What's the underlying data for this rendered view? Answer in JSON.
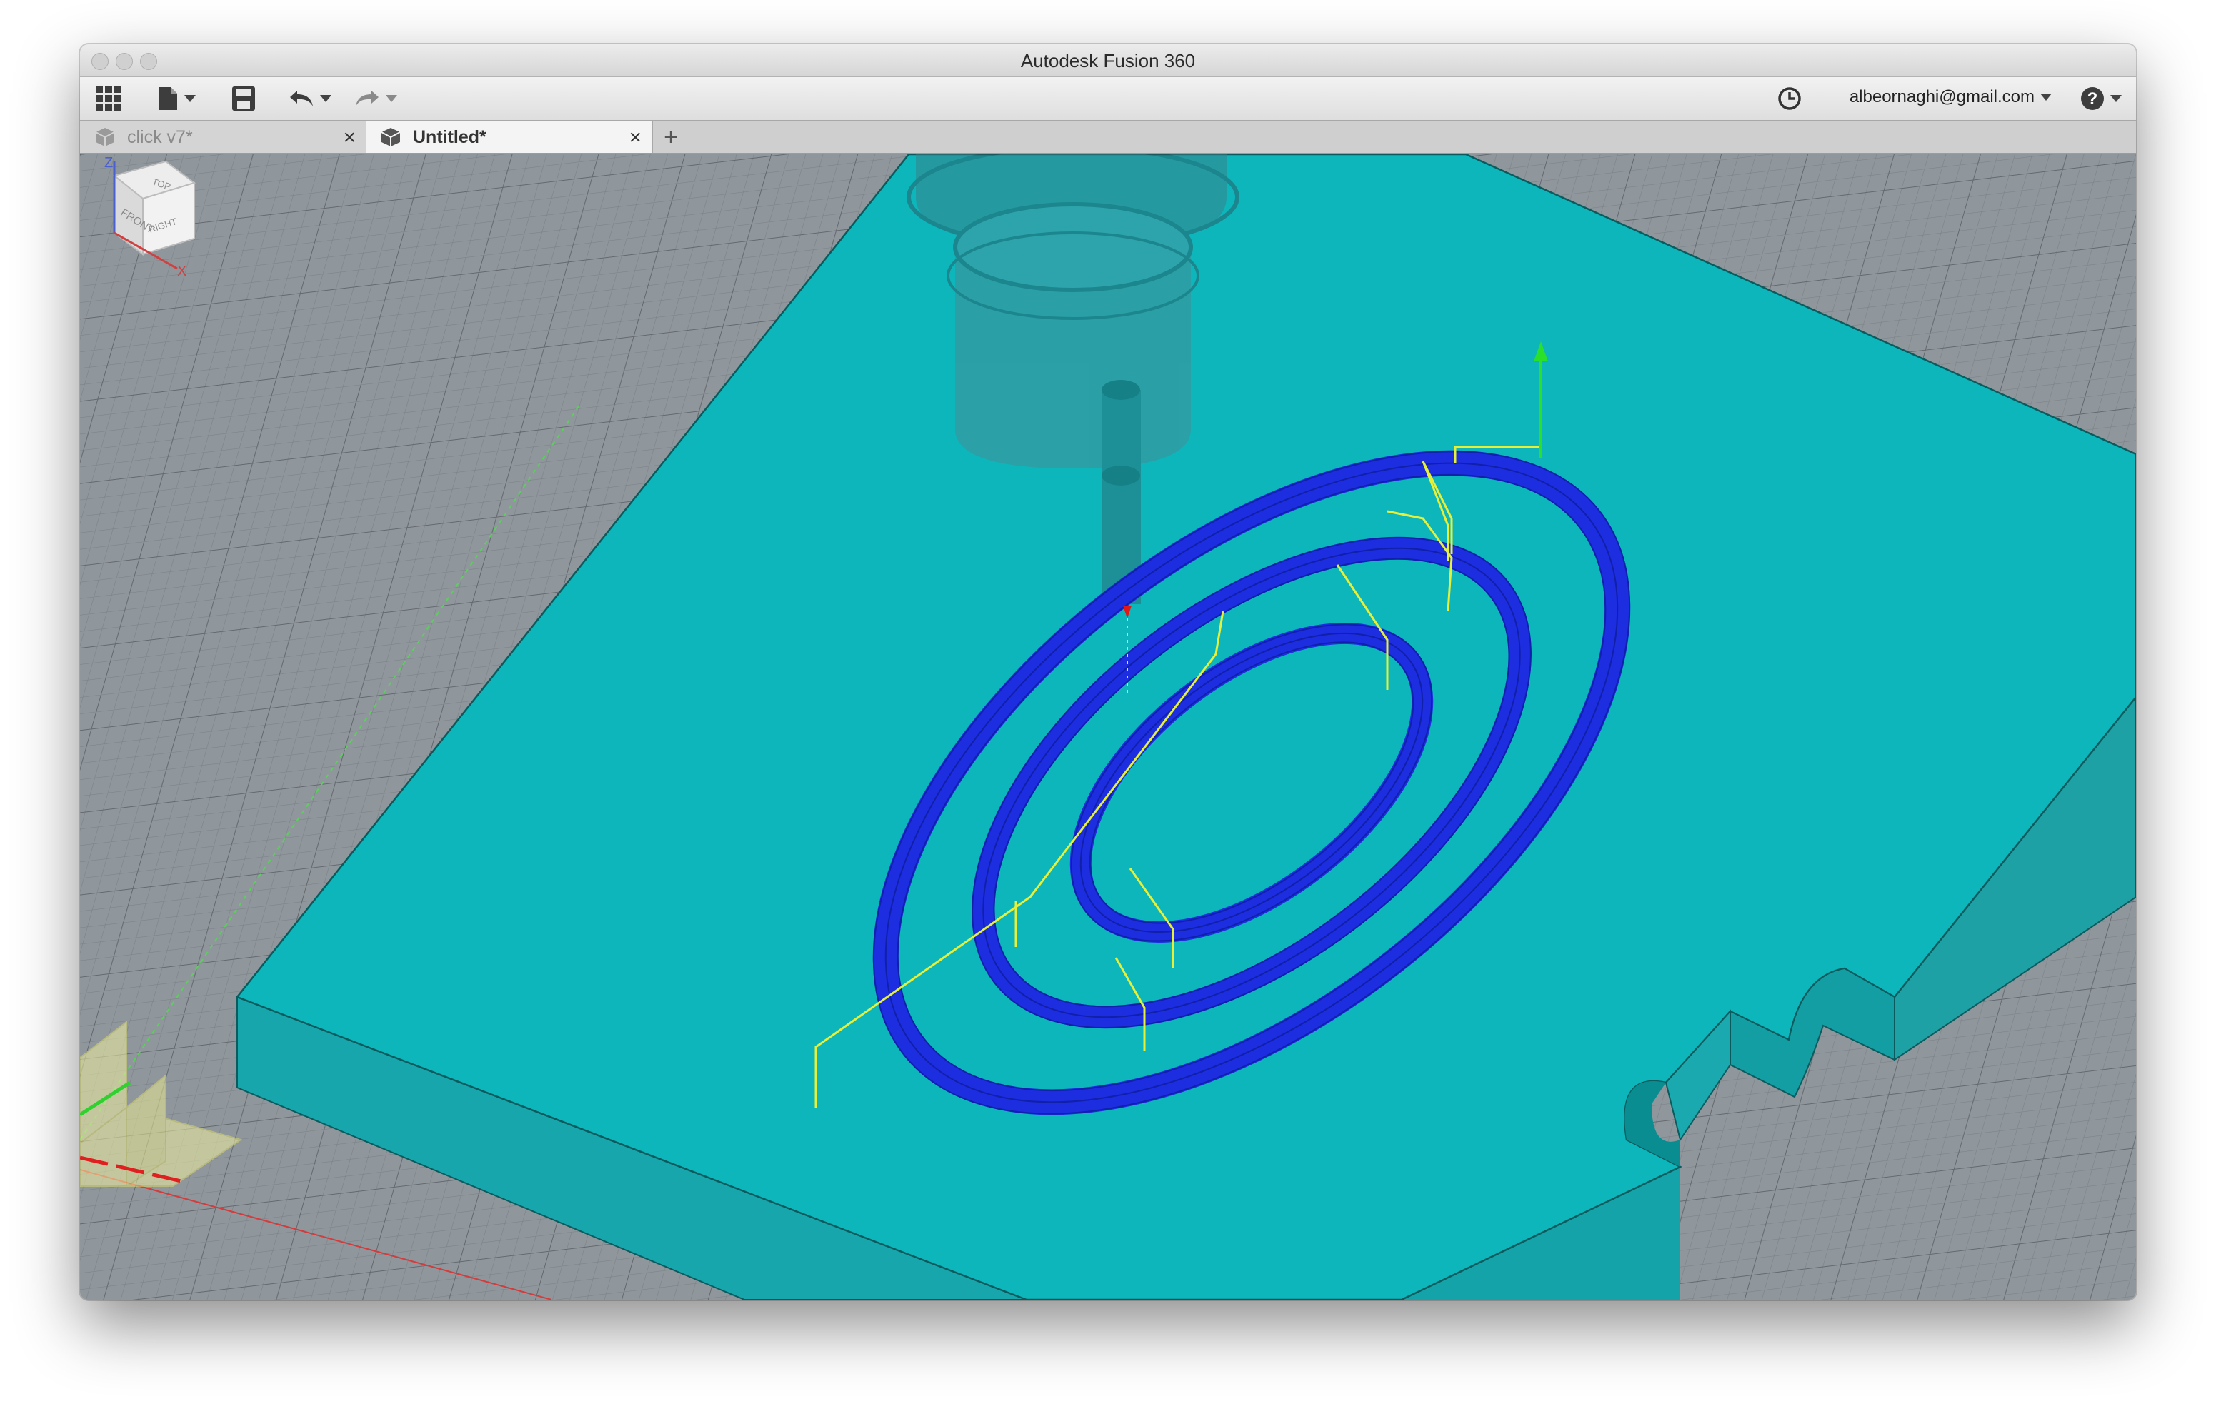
{
  "window": {
    "title": "Autodesk Fusion 360"
  },
  "toolbar": {
    "apps_icon": "grid-icon",
    "file_icon": "document-icon",
    "save_icon": "save-icon",
    "undo_icon": "undo-icon",
    "redo_icon": "redo-icon",
    "history_icon": "clock-icon",
    "user_email": "albeornaghi@gmail.com",
    "help_icon": "help-icon"
  },
  "tabs": [
    {
      "label": "click v7*",
      "active": false
    },
    {
      "label": "Untitled*",
      "active": true
    }
  ],
  "new_tab_label": "+",
  "viewcube": {
    "top": "TOP",
    "front": "FRONT",
    "right": "RIGHT",
    "z_axis": "Z",
    "x_axis": "X"
  },
  "colors": {
    "stock": "#0cb6bb",
    "toolpath": "#1d2de0",
    "link_moves": "#e6f03a",
    "grid_bg": "#8f969c"
  }
}
